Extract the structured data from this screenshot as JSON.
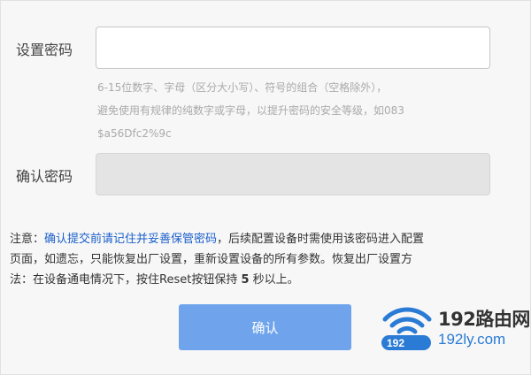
{
  "form": {
    "password_label": "设置密码",
    "password_value": "",
    "hint_line1": "6-15位数字、字母（区分大小写）、符号的组合（空格除外），",
    "hint_line2": "避免使用有规律的纯数字或字母，以提升密码的安全等级，如083",
    "hint_line3": "$a56Dfc2%9c",
    "confirm_label": "确认密码",
    "confirm_value": ""
  },
  "notice": {
    "prefix": "注意：",
    "link": "确认提交前请记住并妥善保管密码",
    "line1_rest": "，后续配置设备时需使用该密码进入配置",
    "line2": "页面，如遗忘，只能恢复出厂设置，重新设置设备的所有参数。恢复出厂设置方",
    "line3_a": "法：在设备通电情况下，按住Reset按钮保持 ",
    "line3_num": "5",
    "line3_b": " 秒以上。"
  },
  "buttons": {
    "confirm": "确认"
  },
  "watermark": {
    "title": "192路由网",
    "url": "192ly.com",
    "badge": "192"
  },
  "colors": {
    "link": "#1a5fcb",
    "button": "#6fa4ec",
    "watermark_blue": "#2a7bd6"
  }
}
